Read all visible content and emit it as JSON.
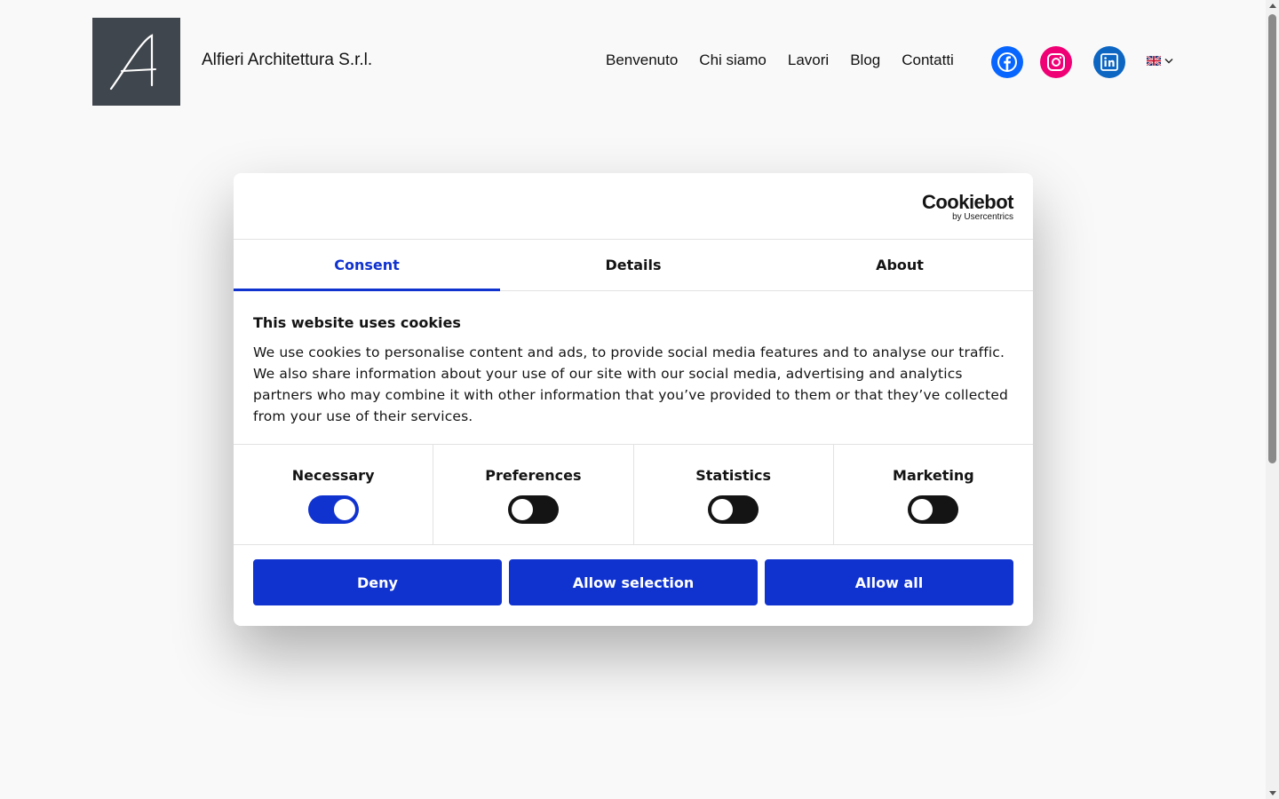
{
  "site": {
    "brand_name": "Alfieri Architettura S.r.l.",
    "logo_letter": "A"
  },
  "nav": {
    "items": [
      "Benvenuto",
      "Chi siamo",
      "Lavori",
      "Blog",
      "Contatti"
    ]
  },
  "social": {
    "icons": [
      "facebook-icon",
      "instagram-icon",
      "linkedin-icon"
    ],
    "colors": {
      "facebook": "#0866ff",
      "instagram": "#f00075",
      "linkedin": "#0d66c2"
    }
  },
  "language": {
    "icon": "uk-flag-icon"
  },
  "dialog": {
    "logo_word": "Cookiebot",
    "logo_sub": "by Usercentrics",
    "tabs": [
      "Consent",
      "Details",
      "About"
    ],
    "active_tab": "Consent",
    "heading": "This website uses cookies",
    "text": "We use cookies to personalise content and ads, to provide social media features and to analyse our traffic. We also share information about your use of our site with our social media, advertising and analytics partners who may combine it with other information that you’ve provided to them or that they’ve collected from your use of their services.",
    "toggles": [
      {
        "label": "Necessary",
        "on": true
      },
      {
        "label": "Preferences",
        "on": false
      },
      {
        "label": "Statistics",
        "on": false
      },
      {
        "label": "Marketing",
        "on": false
      }
    ],
    "buttons": {
      "deny": "Deny",
      "allow_selection": "Allow selection",
      "allow_all": "Allow all"
    },
    "accent_color": "#1032cf"
  }
}
